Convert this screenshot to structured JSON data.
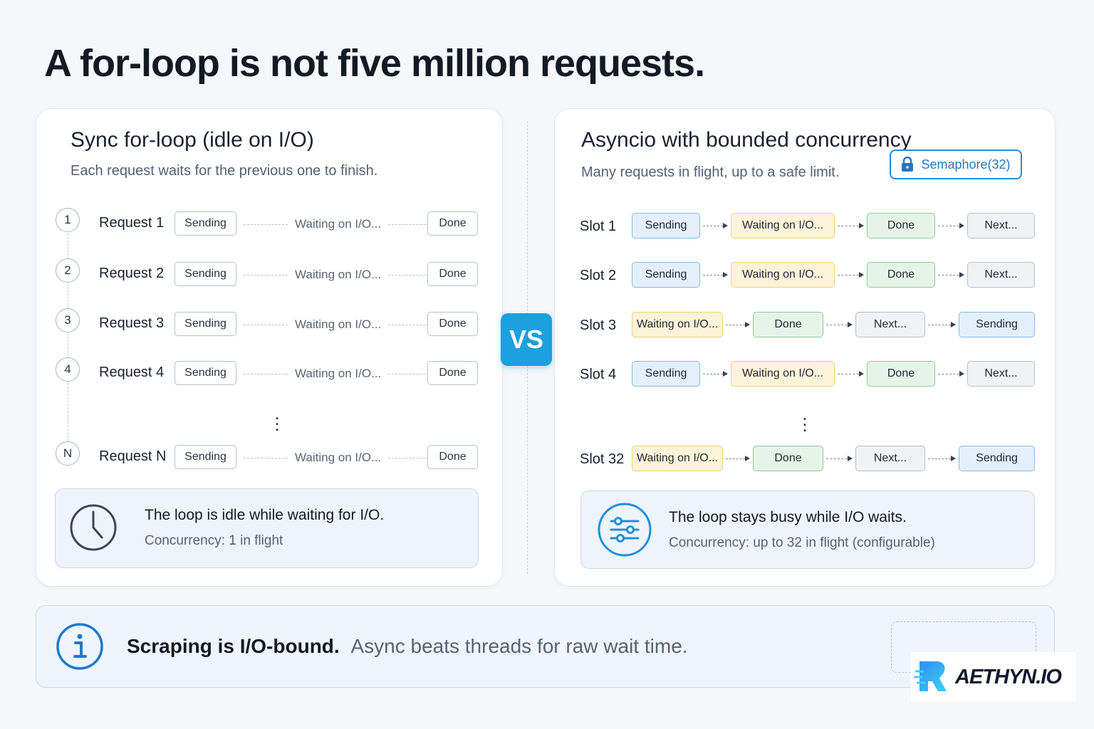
{
  "title": "A for-loop is not five million requests.",
  "left": {
    "title": "Sync for-loop (idle on I/O)",
    "subtitle": "Each request waits for the previous one to finish.",
    "rows": [
      {
        "num": "1",
        "label": "Request 1",
        "sending": "Sending",
        "waiting": "Waiting on I/O...",
        "done": "Done"
      },
      {
        "num": "2",
        "label": "Request 2",
        "sending": "Sending",
        "waiting": "Waiting on I/O...",
        "done": "Done"
      },
      {
        "num": "3",
        "label": "Request 3",
        "sending": "Sending",
        "waiting": "Waiting on I/O...",
        "done": "Done"
      },
      {
        "num": "4",
        "label": "Request 4",
        "sending": "Sending",
        "waiting": "Waiting on I/O...",
        "done": "Done"
      },
      {
        "num": "N",
        "label": "Request N",
        "sending": "Sending",
        "waiting": "Waiting on I/O...",
        "done": "Done"
      }
    ],
    "callout_title": "The loop is idle while waiting for I/O.",
    "callout_sub": "Concurrency: 1 in flight"
  },
  "vs": "VS",
  "right": {
    "title": "Asyncio with bounded concurrency",
    "subtitle": "Many requests in flight, up to a safe limit.",
    "badge": "Semaphore(32)",
    "slots": [
      {
        "label": "Slot 1",
        "steps": [
          {
            "text": "Sending",
            "kind": "send"
          },
          {
            "text": "Waiting on I/O...",
            "kind": "wait"
          },
          {
            "text": "Done",
            "kind": "done"
          },
          {
            "text": "Next...",
            "kind": "next"
          }
        ]
      },
      {
        "label": "Slot 2",
        "steps": [
          {
            "text": "Sending",
            "kind": "send"
          },
          {
            "text": "Waiting on I/O...",
            "kind": "wait"
          },
          {
            "text": "Done",
            "kind": "done"
          },
          {
            "text": "Next...",
            "kind": "next"
          }
        ]
      },
      {
        "label": "Slot 3",
        "steps": [
          {
            "text": "Waiting on I/O...",
            "kind": "wait"
          },
          {
            "text": "Done",
            "kind": "done"
          },
          {
            "text": "Next...",
            "kind": "next"
          },
          {
            "text": "Sending",
            "kind": "send"
          }
        ]
      },
      {
        "label": "Slot 4",
        "steps": [
          {
            "text": "Sending",
            "kind": "send"
          },
          {
            "text": "Waiting on I/O...",
            "kind": "wait"
          },
          {
            "text": "Done",
            "kind": "done"
          },
          {
            "text": "Next...",
            "kind": "next"
          }
        ]
      },
      {
        "label": "Slot 32",
        "steps": [
          {
            "text": "Waiting on I/O...",
            "kind": "wait"
          },
          {
            "text": "Done",
            "kind": "done"
          },
          {
            "text": "Next...",
            "kind": "next"
          },
          {
            "text": "Sending",
            "kind": "send"
          }
        ]
      }
    ],
    "callout_title": "The loop stays busy while I/O waits.",
    "callout_sub": "Concurrency: up to 32 in flight (configurable)"
  },
  "bottom": {
    "bold": "Scraping is I/O-bound.",
    "rest": "Async beats threads for raw wait time."
  },
  "logo": "AETHYN.IO",
  "colors": {
    "accent": "#1aa1de",
    "sending": "#e3f0fb",
    "waiting": "#fdf3d9",
    "done": "#e6f4e8",
    "next": "#f1f2f5"
  }
}
